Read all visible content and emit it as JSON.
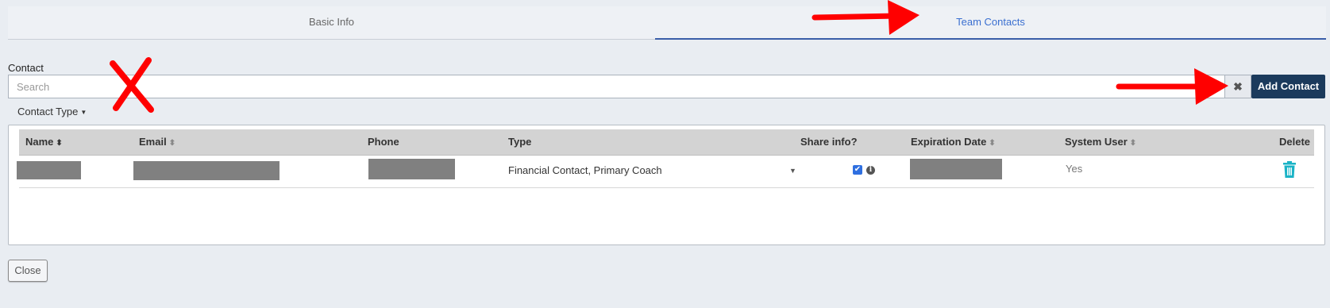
{
  "tabs": [
    {
      "label": "Basic Info",
      "active": false
    },
    {
      "label": "Team Contacts",
      "active": true
    }
  ],
  "contact": {
    "label": "Contact",
    "search_placeholder": "Search",
    "clear_glyph": "✖",
    "add_button": "Add Contact"
  },
  "contact_type": {
    "label": "Contact Type",
    "caret": "▼"
  },
  "table": {
    "headers": {
      "name": "Name",
      "email": "Email",
      "phone": "Phone",
      "type": "Type",
      "share": "Share info?",
      "expiration": "Expiration Date",
      "system_user": "System User",
      "delete": "Delete"
    },
    "sort_glyph": "⬍",
    "rows": [
      {
        "type": "Financial Contact, Primary Coach",
        "type_caret": "▼",
        "share_checked": true,
        "check_glyph": "✔",
        "info_glyph": "i",
        "system_user": "Yes",
        "delete_icon": "trash-icon"
      }
    ]
  },
  "close_button": "Close",
  "colors": {
    "accent_tab": "#3a6fd0",
    "add_button_bg": "#1b3a5c",
    "trash": "#1ab3c6",
    "annotation": "#ff0000",
    "redaction": "#808080"
  }
}
